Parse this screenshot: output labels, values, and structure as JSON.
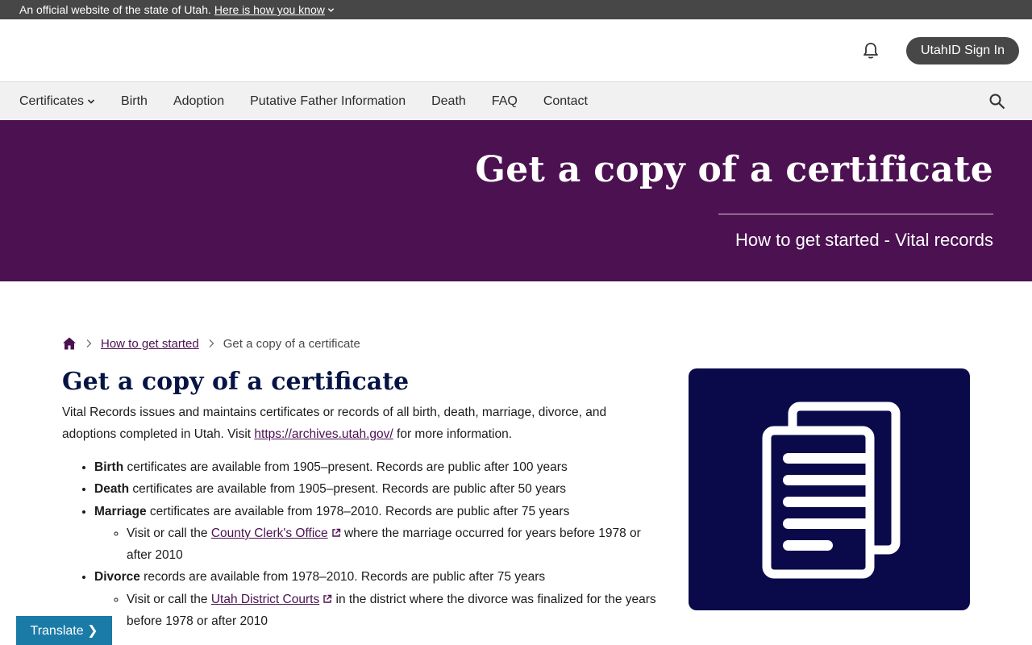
{
  "official_bar": {
    "text": "An official website of the state of Utah.",
    "link": "Here is how you know"
  },
  "header": {
    "signin_label": "UtahID Sign In",
    "bell_icon": "bell-icon"
  },
  "nav": {
    "items": [
      {
        "label": "Certificates",
        "has_dropdown": true
      },
      {
        "label": "Birth"
      },
      {
        "label": "Adoption"
      },
      {
        "label": "Putative Father Information"
      },
      {
        "label": "Death"
      },
      {
        "label": "FAQ"
      },
      {
        "label": "Contact"
      }
    ],
    "search_icon": "search-icon"
  },
  "hero": {
    "title": "Get a copy of a certificate",
    "subtitle": "How to get started - Vital records"
  },
  "breadcrumb": {
    "home_icon": "home-icon",
    "items": [
      {
        "label": "How to get started",
        "link": true
      },
      {
        "label": "Get a copy of a certificate",
        "link": false
      }
    ]
  },
  "main": {
    "title": "Get a copy of a certificate",
    "intro_before": "Vital Records issues and maintains certificates or records of all birth, death, marriage, divorce, and adoptions completed in Utah. Visit ",
    "intro_link": "https://archives.utah.gov/",
    "intro_after": " for more information.",
    "records": [
      {
        "bold": "Birth",
        "text": " certificates are available from 1905–present. Records are public after 100 years"
      },
      {
        "bold": "Death",
        "text": " certificates are available from 1905–present. Records are public after 50 years"
      },
      {
        "bold": "Marriage",
        "text": " certificates are available from 1978–2010. Records are public after 75 years",
        "sub": {
          "before": "Visit or call the ",
          "link": "County Clerk's Office",
          "after": " where the marriage occurred for years before 1978 or after 2010"
        }
      },
      {
        "bold": "Divorce",
        "text": " records are available from 1978–2010. Records are public after 75 years",
        "sub": {
          "before": "Visit or call the ",
          "link": "Utah District Courts",
          "after": " in the district where the divorce was finalized for the years before 1978 or after 2010"
        }
      }
    ]
  },
  "feature_card": {
    "icon": "documents-icon",
    "background": "#0a0a4a"
  },
  "translate": {
    "label": "Translate ❯"
  },
  "colors": {
    "brand_purple": "#4b1151",
    "title_navy": "#061445",
    "official_bar": "#474747",
    "translate_blue": "#1a7ba6"
  }
}
